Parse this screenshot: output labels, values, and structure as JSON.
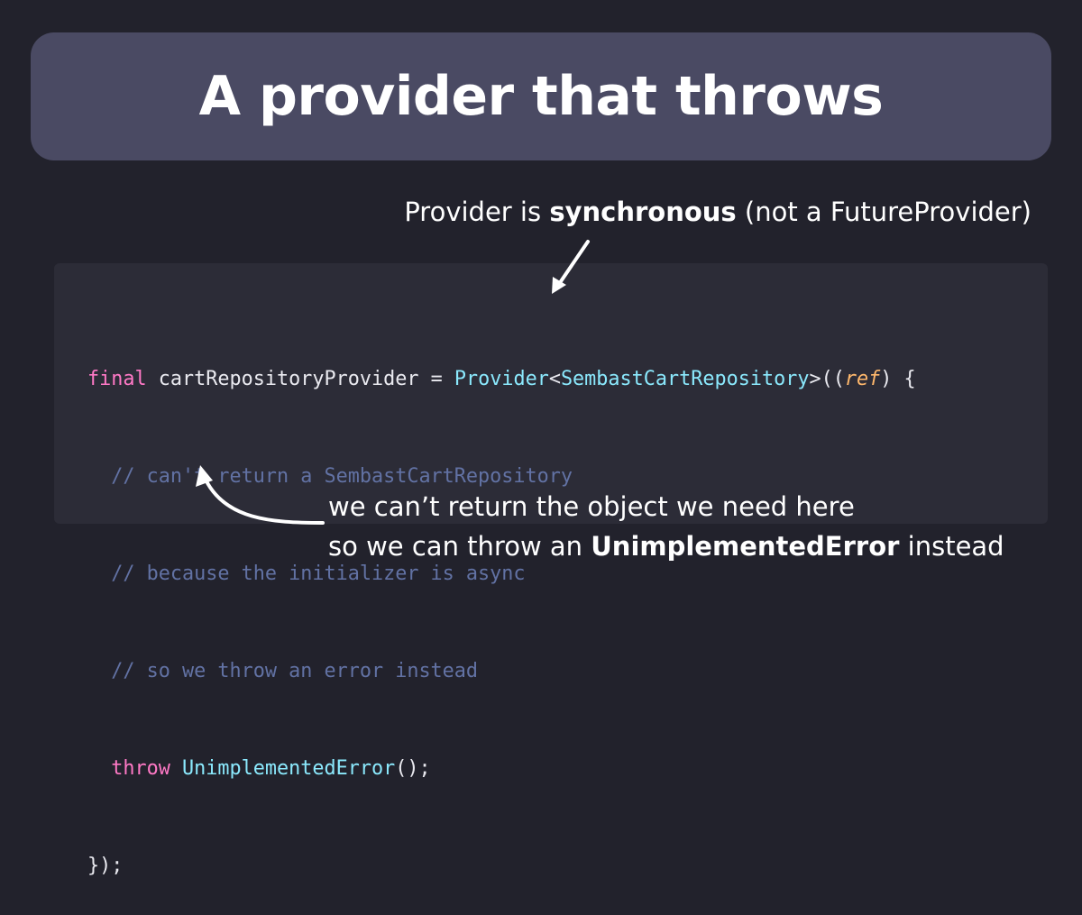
{
  "slide": {
    "title": "A provider that throws"
  },
  "annotation_top": {
    "prefix": "Provider is ",
    "bold": "synchronous",
    "suffix": " (not a FutureProvider)"
  },
  "code": {
    "line1": {
      "kw_final": "final",
      "var_name": " cartRepositoryProvider = ",
      "provider": "Provider",
      "lt": "<",
      "type": "SembastCartRepository",
      "gt_paren": ">((",
      "ref": "ref",
      "close": ") {"
    },
    "line2": "  // can't return a SembastCartRepository",
    "line3": "  // because the initializer is async",
    "line4": "  // so we throw an error instead",
    "line5": {
      "indent": "  ",
      "kw_throw": "throw",
      "space": " ",
      "error_class": "UnimplementedError",
      "call": "();"
    },
    "line6": "});"
  },
  "annotation_bottom": {
    "line1": "we can’t return the object we need here",
    "line2_prefix": "so we can throw an ",
    "line2_bold": "UnimplementedError",
    "line2_suffix": " instead"
  },
  "colors": {
    "background": "#22222c",
    "banner": "#4a4a63",
    "code_panel": "#2c2c37",
    "keyword": "#ff79c6",
    "class": "#8be9fd",
    "param": "#ffb86c",
    "comment": "#6272a4"
  }
}
